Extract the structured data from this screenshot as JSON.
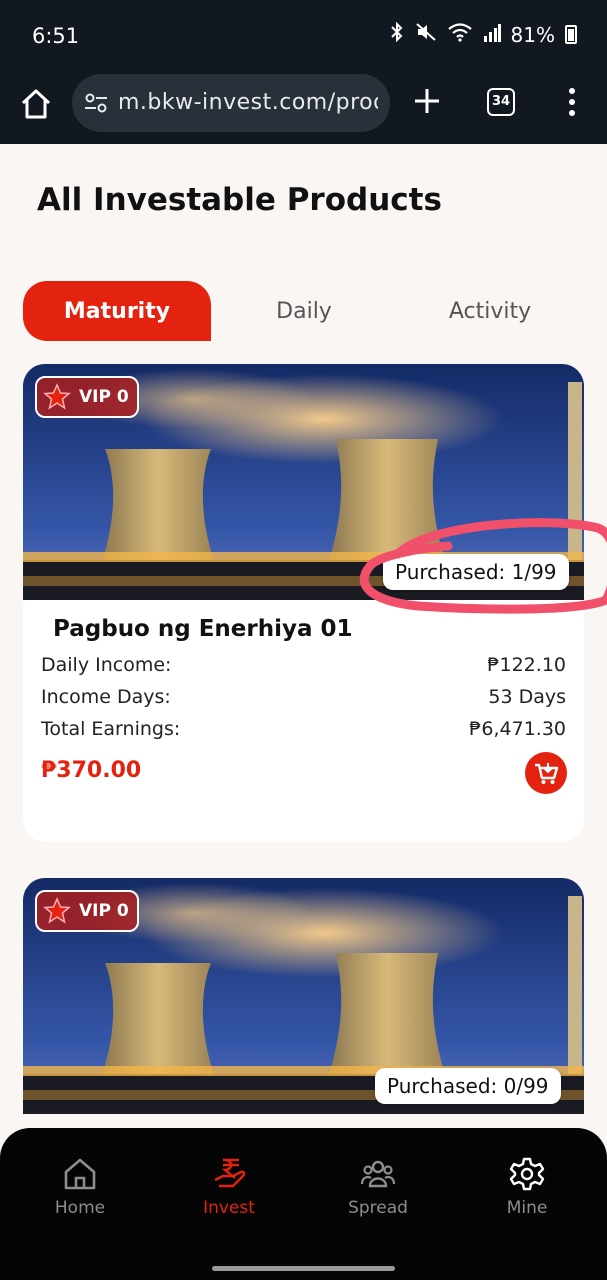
{
  "status_bar": {
    "time": "6:51",
    "battery": "81%",
    "icons": [
      "bluetooth-icon",
      "mute-icon",
      "wifi-icon",
      "signal-icon",
      "battery-icon"
    ]
  },
  "browser": {
    "url": "m.bkw-invest.com/products",
    "tab_count": "34"
  },
  "page": {
    "title": "All Investable Products"
  },
  "tabs": [
    {
      "label": "Maturity",
      "active": true
    },
    {
      "label": "Daily",
      "active": false
    },
    {
      "label": "Activity",
      "active": false
    }
  ],
  "products": [
    {
      "vip": "VIP 0",
      "purchased": "Purchased: 1/99",
      "name": "Pagbuo ng Enerhiya 01",
      "daily_income_label": "Daily Income:",
      "daily_income": "₱122.10",
      "income_days_label": "Income Days:",
      "income_days": "53 Days",
      "total_earnings_label": "Total Earnings:",
      "total_earnings": "₱6,471.30",
      "price": "₱370.00"
    },
    {
      "vip": "VIP 0",
      "purchased": "Purchased: 0/99"
    }
  ],
  "bottom_nav": [
    {
      "label": "Home",
      "icon": "home-icon",
      "active": false
    },
    {
      "label": "Invest",
      "icon": "invest-icon",
      "active": true
    },
    {
      "label": "Spread",
      "icon": "people-icon",
      "active": false
    },
    {
      "label": "Mine",
      "icon": "gear-icon",
      "active": false
    }
  ],
  "colors": {
    "accent": "#e3230f",
    "status_bar_bg": "#121820",
    "page_bg": "#faf6f3",
    "nav_bg": "#050505",
    "highlight_ring": "#f0506a"
  }
}
